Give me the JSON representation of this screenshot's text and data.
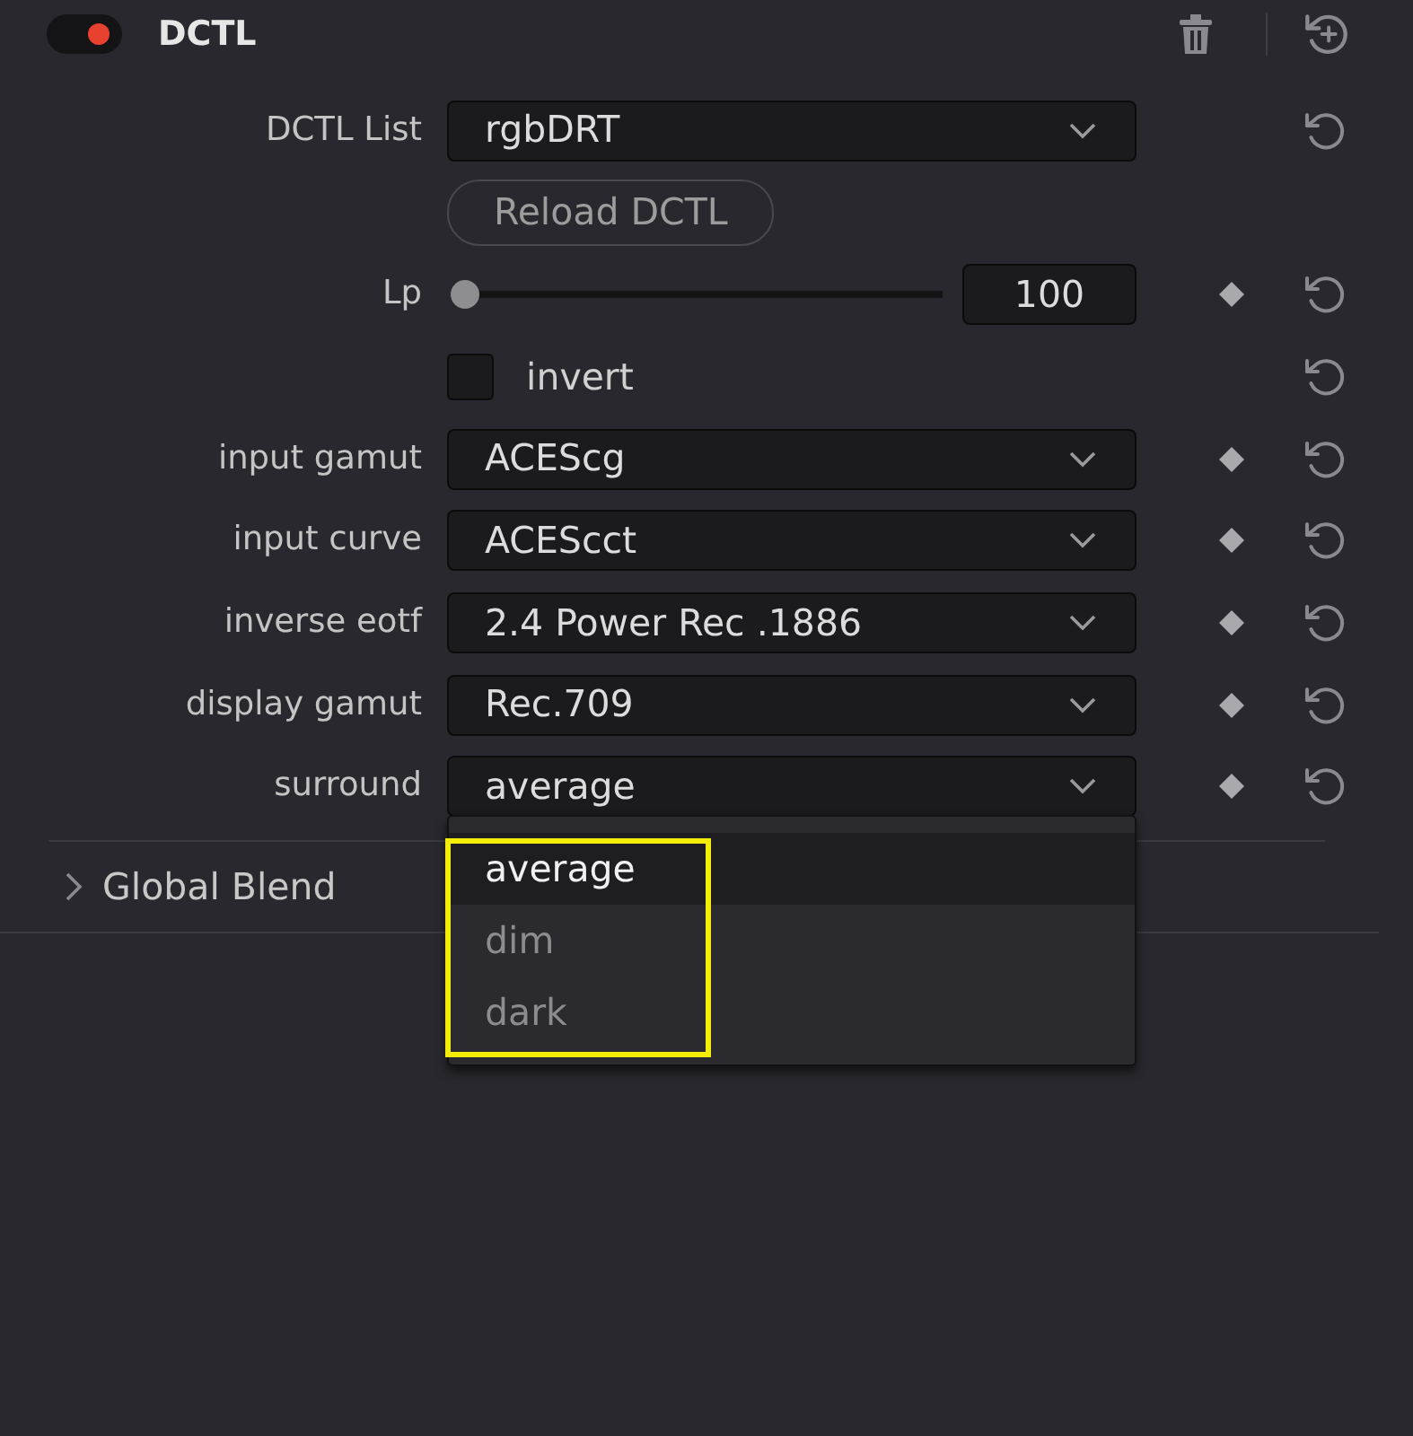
{
  "header": {
    "enabled": true,
    "title": "DCTL"
  },
  "params": [
    {
      "kind": "dropdown",
      "label": "DCTL List",
      "value": "rgbDRT",
      "expanded": false,
      "keyframe": false,
      "reset": true
    },
    {
      "kind": "button",
      "label": "Reload DCTL",
      "keyframe": false,
      "reset": false
    },
    {
      "kind": "slider",
      "label": "Lp",
      "level": 0,
      "value": "100",
      "keyframe": true,
      "reset": true
    },
    {
      "kind": "checkbox",
      "label": "invert",
      "checked": false,
      "keyframe": false,
      "reset": true
    },
    {
      "kind": "dropdown",
      "label": "input gamut",
      "value": "ACEScg",
      "expanded": false,
      "keyframe": true,
      "reset": true
    },
    {
      "kind": "dropdown",
      "label": "input curve",
      "value": "ACEScct",
      "expanded": false,
      "keyframe": true,
      "reset": true
    },
    {
      "kind": "dropdown",
      "label": "inverse eotf",
      "value": "2.4 Power Rec .1886",
      "expanded": false,
      "keyframe": true,
      "reset": true
    },
    {
      "kind": "dropdown",
      "label": "display gamut",
      "value": "Rec.709",
      "expanded": false,
      "keyframe": true,
      "reset": true
    },
    {
      "kind": "dropdown",
      "label": "surround",
      "value": "average",
      "expanded": true,
      "highlighted": true,
      "keyframe": true,
      "reset": true,
      "options": [
        {
          "label": "average",
          "selected": true
        },
        {
          "label": "dim",
          "selected": false
        },
        {
          "label": "dark",
          "selected": false
        }
      ]
    }
  ],
  "sections": [
    {
      "label": "Global Blend",
      "expanded": false
    }
  ]
}
